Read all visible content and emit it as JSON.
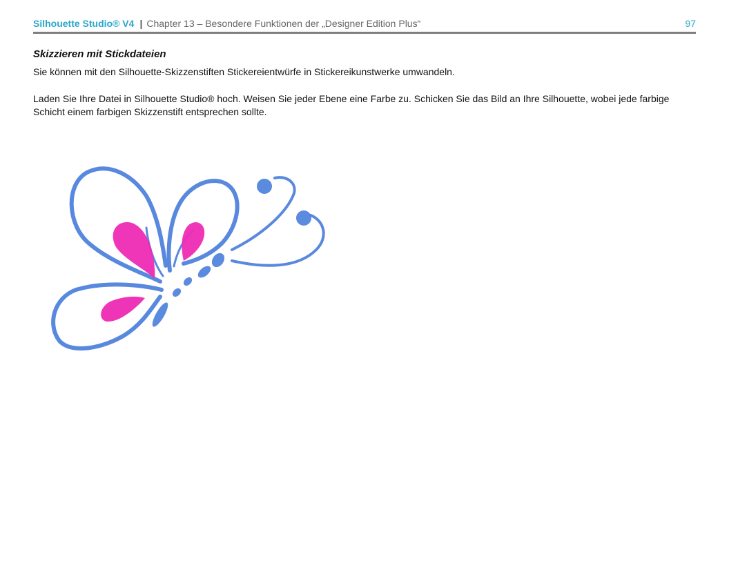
{
  "header": {
    "brand": "Silhouette Studio® V4",
    "separator": "|",
    "chapter": "Chapter 13 – Besondere Funktionen der „Designer Edition Plus“",
    "page_number": "97"
  },
  "section": {
    "title": "Skizzieren mit Stickdateien",
    "paragraphs": [
      "Sie können mit den Silhouette-Skizzenstiften Stickereientwürfe in Stickereikunstwerke umwandeln.",
      "Laden Sie Ihre Datei in Silhouette Studio® hoch. Weisen Sie jeder Ebene eine Farbe zu. Schicken Sie das Bild an Ihre Silhouette, wobei jede farbige Schicht einem farbigen Skizzenstift entsprechen sollte."
    ]
  },
  "figure": {
    "subject": "butterfly-sketch",
    "colors": {
      "outline": "#4a7fdc",
      "fill": "#ee2bb4"
    }
  },
  "colors": {
    "accent": "#2aa7c8",
    "rule": "#7f7f7f",
    "text": "#111111"
  }
}
